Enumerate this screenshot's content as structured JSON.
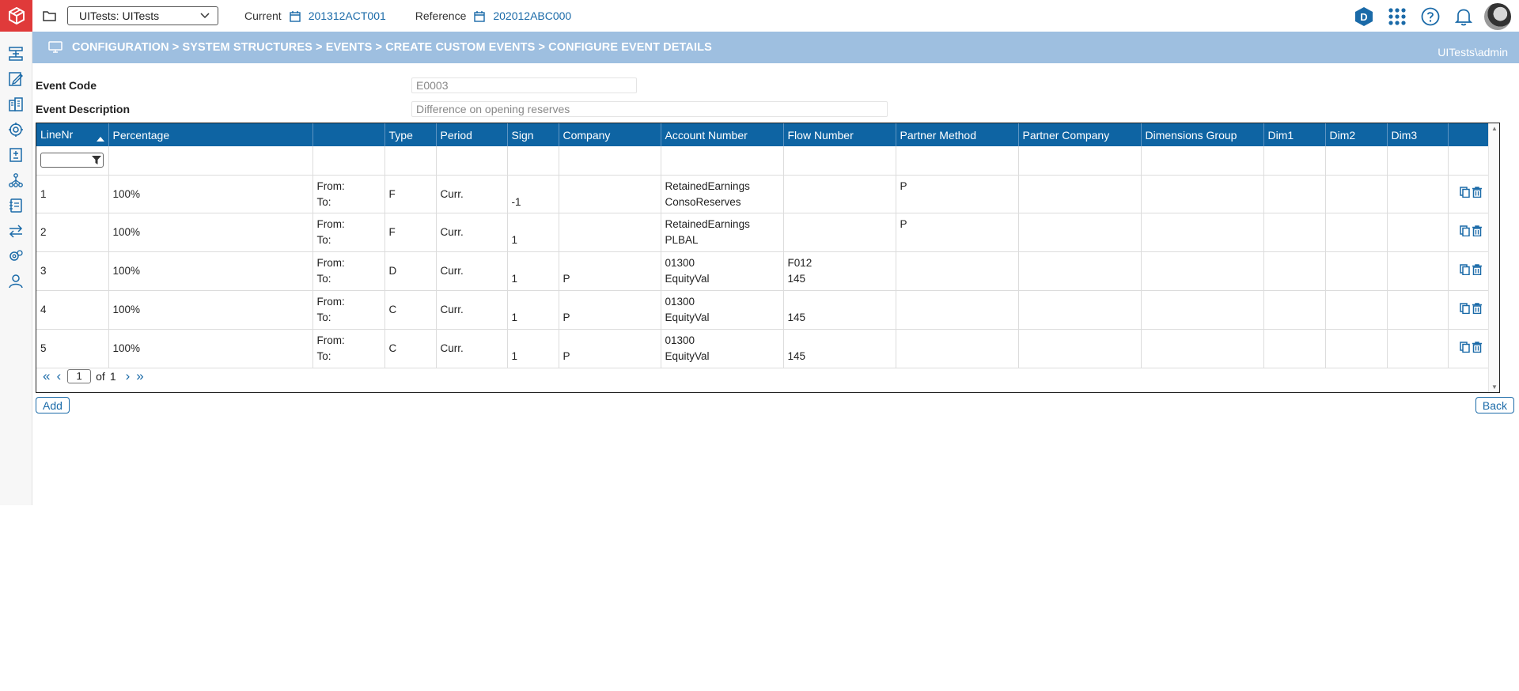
{
  "topbar": {
    "workspace": "UITests: UITests",
    "current_label": "Current",
    "current_value": "201312ACT001",
    "reference_label": "Reference",
    "reference_value": "202012ABC000",
    "d_badge": "D"
  },
  "breadcrumb": {
    "path": "CONFIGURATION > SYSTEM STRUCTURES > EVENTS > CREATE CUSTOM EVENTS > CONFIGURE EVENT DETAILS",
    "user": "UITests\\admin"
  },
  "form": {
    "event_code_label": "Event Code",
    "event_code_value": "E0003",
    "event_desc_label": "Event Description",
    "event_desc_value": "Difference on opening reserves"
  },
  "grid": {
    "columns": [
      "LineNr",
      "Percentage",
      "",
      "Type",
      "Period",
      "Sign",
      "Company",
      "Account Number",
      "Flow Number",
      "Partner Method",
      "Partner Company",
      "Dimensions Group",
      "Dim1",
      "Dim2",
      "Dim3",
      ""
    ],
    "from_label": "From:",
    "to_label": "To:",
    "rows": [
      {
        "line": "1",
        "pct": "100%",
        "type": "F",
        "period": "Curr.",
        "sign": "-1",
        "company": "",
        "acct_from": "RetainedEarnings",
        "acct_to": "ConsoReserves",
        "flow_from": "",
        "flow_to": "",
        "partner_method": "P"
      },
      {
        "line": "2",
        "pct": "100%",
        "type": "F",
        "period": "Curr.",
        "sign": "1",
        "company": "",
        "acct_from": "RetainedEarnings",
        "acct_to": "PLBAL",
        "flow_from": "",
        "flow_to": "",
        "partner_method": "P"
      },
      {
        "line": "3",
        "pct": "100%",
        "type": "D",
        "period": "Curr.",
        "sign": "1",
        "company": "P",
        "acct_from": "01300",
        "acct_to": "EquityVal",
        "flow_from": "F012",
        "flow_to": "145",
        "partner_method": ""
      },
      {
        "line": "4",
        "pct": "100%",
        "type": "C",
        "period": "Curr.",
        "sign": "1",
        "company": "P",
        "acct_from": "01300",
        "acct_to": "EquityVal",
        "flow_from": "",
        "flow_to": "145",
        "partner_method": ""
      },
      {
        "line": "5",
        "pct": "100%",
        "type": "C",
        "period": "Curr.",
        "sign": "1",
        "company": "P",
        "acct_from": "01300",
        "acct_to": "EquityVal",
        "flow_from": "",
        "flow_to": "145",
        "partner_method": ""
      }
    ],
    "pager": {
      "page": "1",
      "of_label": "of",
      "total": "1"
    }
  },
  "buttons": {
    "add": "Add",
    "back": "Back"
  },
  "colors": {
    "header_blue": "#0e64a3",
    "crumb_blue": "#9ebfe0",
    "logo_red": "#e03a3a",
    "link_blue": "#1a6aa8"
  }
}
